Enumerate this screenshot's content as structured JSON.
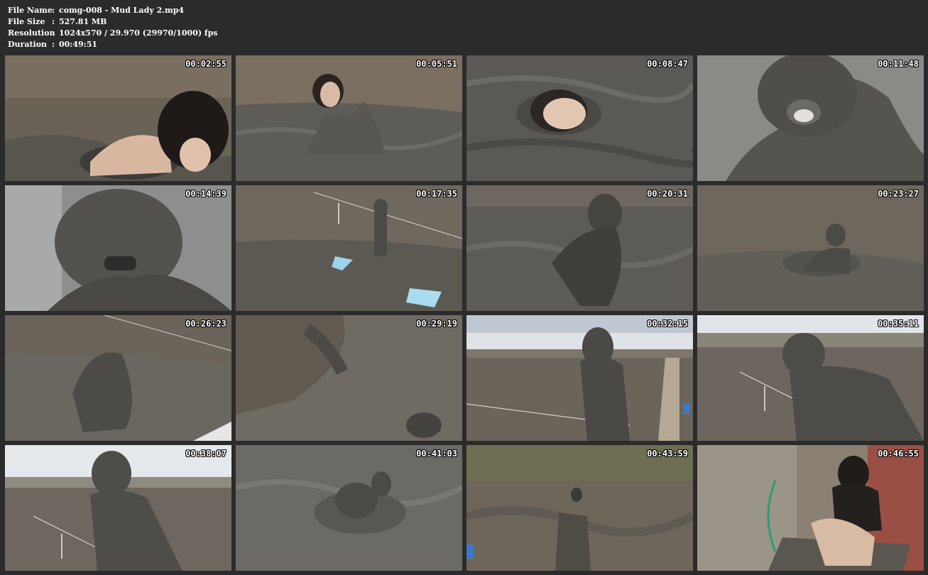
{
  "header": {
    "rows": [
      {
        "label": "File Name",
        "sep": ":",
        "value": "comg-008 - Mud Lady 2.mp4"
      },
      {
        "label": "File Size",
        "sep": ":",
        "value": "527.81 MB"
      },
      {
        "label": "Resolution",
        "sep": ":",
        "value": "1024x570 / 29.970 (29970/1000) fps"
      },
      {
        "label": "Duration",
        "sep": ":",
        "value": "00:49:51"
      }
    ]
  },
  "thumbnails": [
    {
      "timestamp": "00:02:55",
      "scene": "woman-dark-hair-lying-in-mud"
    },
    {
      "timestamp": "00:05:51",
      "scene": "woman-sitting-in-mud-pool"
    },
    {
      "timestamp": "00:08:47",
      "scene": "face-above-mud-surface"
    },
    {
      "timestamp": "00:11:48",
      "scene": "mud-covered-face-closeup"
    },
    {
      "timestamp": "00:14:39",
      "scene": "mud-covered-head-closeup"
    },
    {
      "timestamp": "00:17:35",
      "scene": "figure-walking-in-mud-field"
    },
    {
      "timestamp": "00:20:31",
      "scene": "figure-crawling-in-mud"
    },
    {
      "timestamp": "00:23:27",
      "scene": "figure-sitting-far-in-mud"
    },
    {
      "timestamp": "00:26:23",
      "scene": "figure-bent-over-in-mud"
    },
    {
      "timestamp": "00:29:19",
      "scene": "mud-surface-with-shadow"
    },
    {
      "timestamp": "00:32:15",
      "scene": "figure-standing-by-walkway"
    },
    {
      "timestamp": "00:35:11",
      "scene": "figure-walking-field-view"
    },
    {
      "timestamp": "00:38:07",
      "scene": "figure-back-view-sky"
    },
    {
      "timestamp": "00:41:03",
      "scene": "figure-submerged-in-mud"
    },
    {
      "timestamp": "00:43:59",
      "scene": "figure-distant-mud-bank"
    },
    {
      "timestamp": "00:46:55",
      "scene": "woman-rinsing-with-hose"
    }
  ],
  "colors": {
    "background": "#2b2b2b",
    "text": "#ffffff",
    "mud": "#5f5d57",
    "sky": "#dfe3e8"
  }
}
